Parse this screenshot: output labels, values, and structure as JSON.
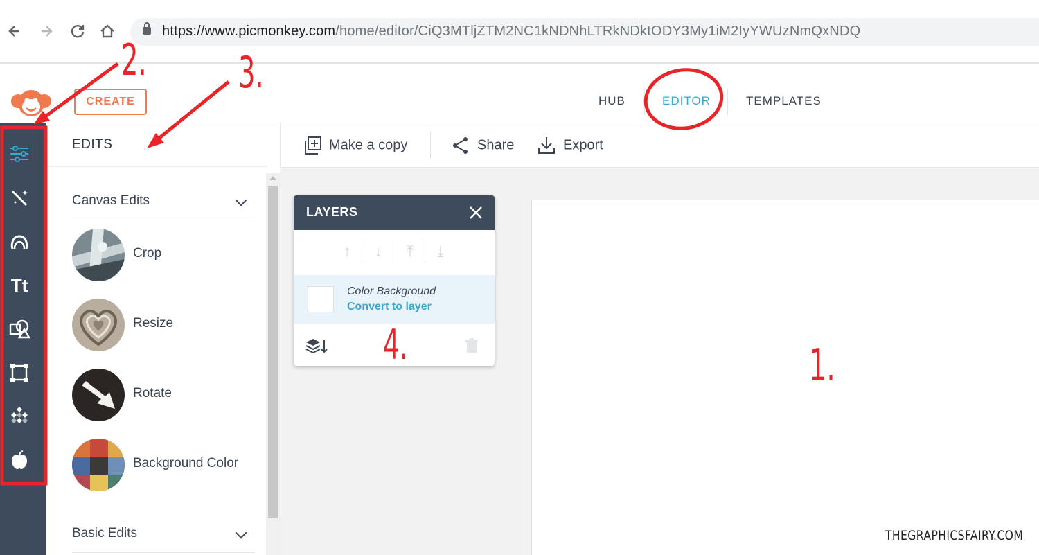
{
  "browser": {
    "url_host": "https://www.picmonkey.com",
    "url_path": "/home/editor/CiQ3MTljZTM2NC1kNDNhLTRkNDktODY3My1iM2IyYWUzNmQxNDQ",
    "icons": [
      "back-arrow-icon",
      "forward-arrow-icon",
      "reload-icon",
      "home-icon",
      "lock-icon"
    ]
  },
  "header": {
    "create_label": "CREATE",
    "nav": {
      "hub": "HUB",
      "editor": "EDITOR",
      "templates": "TEMPLATES"
    }
  },
  "rail": {
    "items": [
      "edits-icon",
      "effects-icon",
      "touch-up-icon",
      "text-icon",
      "graphics-icon",
      "frames-icon",
      "textures-icon",
      "themes-icon"
    ],
    "active": "edits-icon"
  },
  "edits_panel": {
    "title": "EDITS",
    "sections": [
      {
        "label": "Canvas Edits",
        "tools": [
          "Crop",
          "Resize",
          "Rotate",
          "Background Color"
        ]
      },
      {
        "label": "Basic Edits"
      }
    ]
  },
  "toolbar": {
    "make_copy": "Make a copy",
    "share": "Share",
    "export": "Export"
  },
  "layers": {
    "title": "LAYERS",
    "layer_name": "Color Background",
    "layer_action": "Convert to layer"
  },
  "annotations": {
    "n1": "1.",
    "n2": "2.",
    "n3": "3.",
    "n4": "4.",
    "color": "#e8262a"
  },
  "watermark": "THEGRAPHICSFAIRY.COM",
  "colors": {
    "accent_blue": "#3aa8cf",
    "create_orange": "#ef7a4f",
    "rail_dark": "#3d4b5c"
  }
}
